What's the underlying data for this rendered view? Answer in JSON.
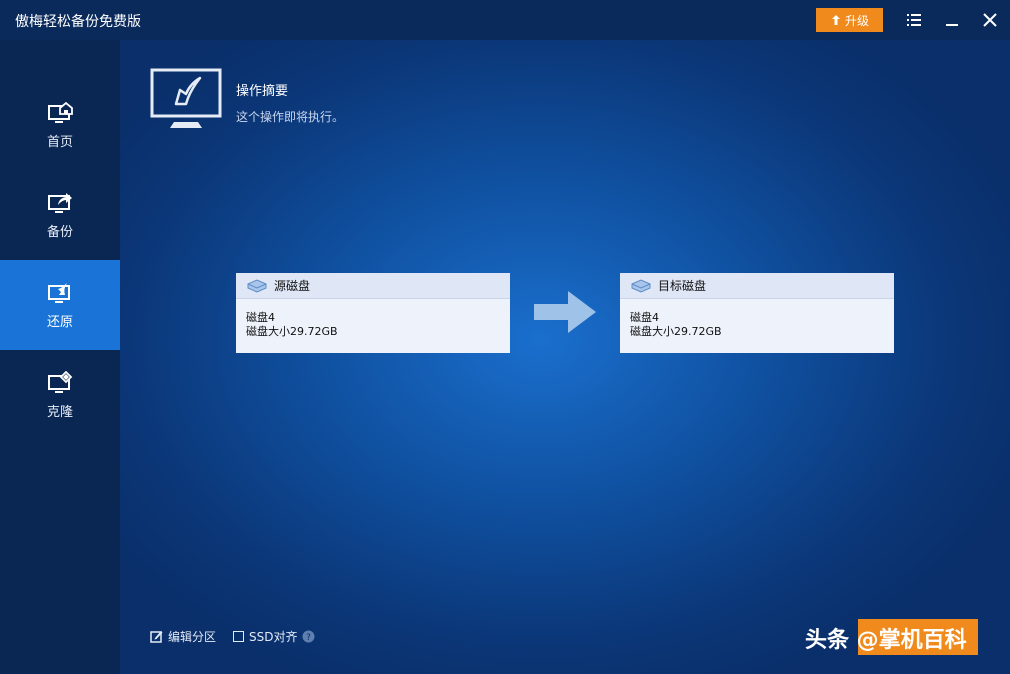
{
  "window": {
    "title": "傲梅轻松备份免费版",
    "upgrade_label": "升级"
  },
  "sidebar": {
    "items": [
      {
        "label": "首页",
        "icon": "home-icon"
      },
      {
        "label": "备份",
        "icon": "backup-icon"
      },
      {
        "label": "还原",
        "icon": "restore-icon",
        "active": true
      },
      {
        "label": "克隆",
        "icon": "clone-icon"
      }
    ]
  },
  "summary": {
    "title": "操作摘要",
    "subtitle": "这个操作即将执行。"
  },
  "source": {
    "header": "源磁盘",
    "name": "磁盘4",
    "size": "磁盘大小29.72GB"
  },
  "target": {
    "header": "目标磁盘",
    "name": "磁盘4",
    "size": "磁盘大小29.72GB"
  },
  "options": {
    "edit_partition": "编辑分区",
    "ssd_align": "SSD对齐"
  },
  "watermark": {
    "text": "头条 @掌机百科"
  },
  "colors": {
    "accent": "#1a73d6",
    "upgrade": "#f08a1c",
    "titlebar": "#0b2a5c"
  }
}
